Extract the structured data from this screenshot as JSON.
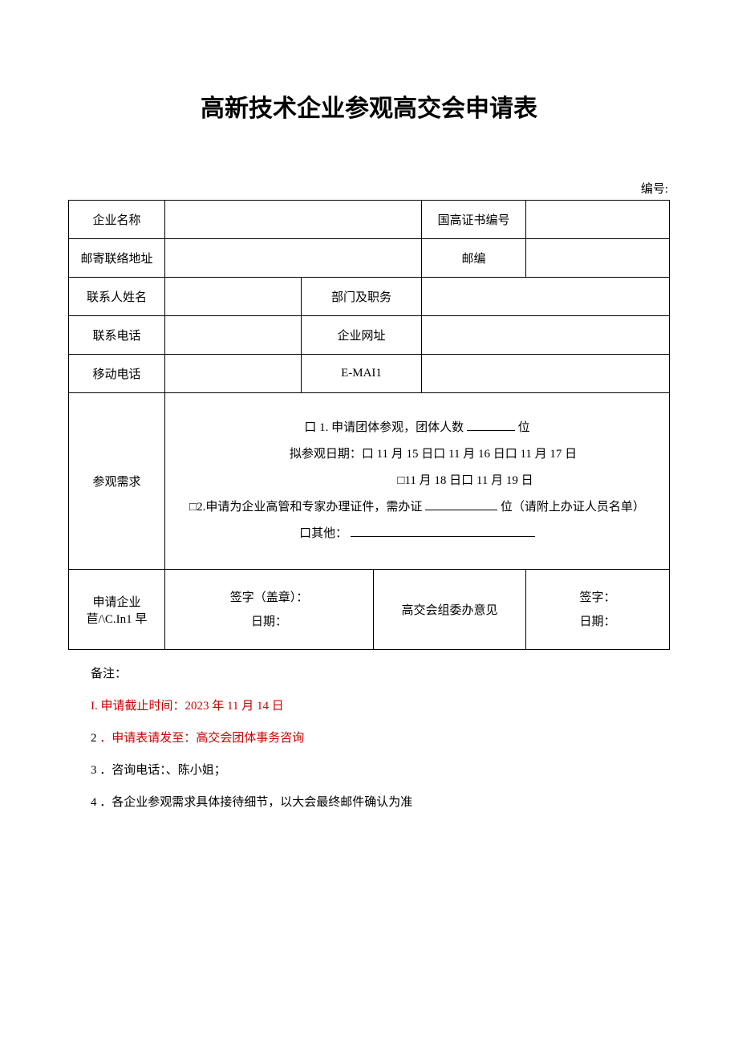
{
  "title": "高新技术企业参观高交会申请表",
  "serial_label": "编号:",
  "labels": {
    "company_name": "企业名称",
    "cert_no": "国高证书编号",
    "mailing_address": "邮寄联络地址",
    "postcode": "邮编",
    "contact_name": "联系人姓名",
    "dept_title": "部门及职务",
    "phone": "联系电话",
    "website": "企业网址",
    "mobile": "移动电话",
    "email": "E-MAI1",
    "visit_demand": "参观需求",
    "applicant_opinion_l1": "申请企业",
    "applicant_opinion_l2": "苣/\\C.In1 早",
    "org_opinion": "高交会组委办意见",
    "sign_seal": "签字（盖章）：",
    "sign": "签字：",
    "date": "日期："
  },
  "demand": {
    "opt1_prefix": "口 1. 申请团体参观，团体人数",
    "opt1_suffix": "位",
    "dates_label": "拟参观日期：口 11 月 15 日口 11 月 16 日口 11 月 17 日",
    "dates_label2": "□11 月 18 日口 11 月 19 日",
    "opt2_prefix": "□2.申请为企业高管和专家办理证件，需办证",
    "opt2_suffix": "位（请附上办证人员名单）",
    "other": "口其他："
  },
  "notes": {
    "header": "备注：",
    "n1": "I. 申请截止时间：2023 年 11 月 14 日",
    "n2a": "2",
    "n2b": "．申请表请发至：高交会团体事务咨询",
    "n3": "3 ．咨询电话：、陈小姐；",
    "n4": "4 ．各企业参观需求具体接待细节，以大会最终邮件确认为准"
  }
}
